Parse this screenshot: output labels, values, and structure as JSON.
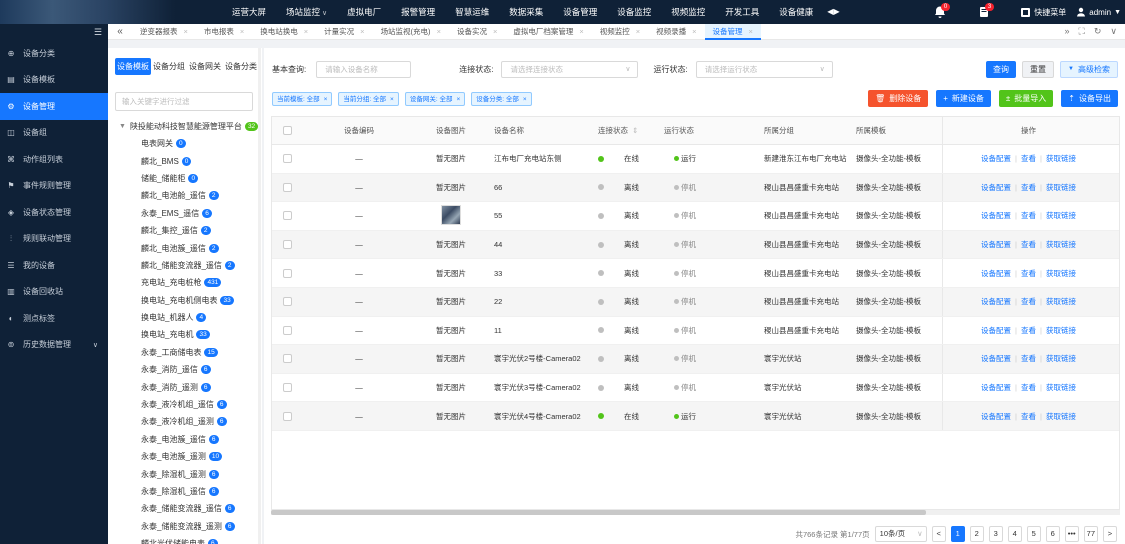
{
  "topnav": {
    "items": [
      "运营大屏",
      "场站监控",
      "虚拟电厂",
      "报警管理",
      "智慧运维",
      "数据采集",
      "设备管理",
      "设备监控",
      "视频监控",
      "开发工具",
      "设备健康"
    ],
    "alarm_badge": "0",
    "message_badge": "3",
    "quick_menu": "快捷菜单",
    "user": "admin"
  },
  "sidebar": {
    "items": [
      {
        "label": "设备分类",
        "icon": "classify-icon"
      },
      {
        "label": "设备模板",
        "icon": "template-icon"
      },
      {
        "label": "设备管理",
        "icon": "device-manage-icon"
      },
      {
        "label": "设备组",
        "icon": "group-icon"
      },
      {
        "label": "动作组列表",
        "icon": "action-icon"
      },
      {
        "label": "事件规则管理",
        "icon": "event-icon"
      },
      {
        "label": "设备状态管理",
        "icon": "status-icon"
      },
      {
        "label": "规则联动管理",
        "icon": "rule-icon"
      },
      {
        "label": "我的设备",
        "icon": "my-device-icon"
      },
      {
        "label": "设备回收站",
        "icon": "recycle-icon"
      },
      {
        "label": "测点标签",
        "icon": "tag-icon"
      },
      {
        "label": "历史数据管理",
        "icon": "history-icon"
      }
    ],
    "active_index": 2
  },
  "tabs": [
    "逆变器报表",
    "市电报表",
    "换电站换电",
    "计量实况",
    "场站监视(充电)",
    "设备实况",
    "虚拟电厂档案管理",
    "视频监控",
    "视频录播",
    "设备管理"
  ],
  "active_tab_index": 9,
  "left_panel": {
    "tabs": [
      "设备模板",
      "设备分组",
      "设备网关",
      "设备分类"
    ],
    "filter_placeholder": "输入关键字进行过滤",
    "root": {
      "label": "陕投能动科技智慧能源管理平台",
      "count": "32"
    },
    "nodes": [
      {
        "label": "电表网关",
        "count": "0"
      },
      {
        "label": "麟北_BMS",
        "count": "0"
      },
      {
        "label": "储能_储能柜",
        "count": "0"
      },
      {
        "label": "麟北_电池舱_遥信",
        "count": "2"
      },
      {
        "label": "永泰_EMS_遥信",
        "count": "6"
      },
      {
        "label": "麟北_集控_遥信",
        "count": "2"
      },
      {
        "label": "麟北_电池簇_遥信",
        "count": "2"
      },
      {
        "label": "麟北_储能变流器_遥信",
        "count": "2"
      },
      {
        "label": "充电站_充电桩枪",
        "count": "431"
      },
      {
        "label": "换电站_充电机侧电表",
        "count": "33"
      },
      {
        "label": "换电站_机器人",
        "count": "4"
      },
      {
        "label": "换电站_充电机",
        "count": "33"
      },
      {
        "label": "永泰_工商储电表",
        "count": "15"
      },
      {
        "label": "永泰_消防_遥信",
        "count": "6"
      },
      {
        "label": "永泰_消防_遥测",
        "count": "6"
      },
      {
        "label": "永泰_液冷机组_遥信",
        "count": "6"
      },
      {
        "label": "永泰_液冷机组_遥测",
        "count": "6"
      },
      {
        "label": "永泰_电池簇_遥信",
        "count": "6"
      },
      {
        "label": "永泰_电池簇_遥测",
        "count": "10"
      },
      {
        "label": "永泰_除湿机_遥测",
        "count": "6"
      },
      {
        "label": "永泰_除湿机_遥信",
        "count": "6"
      },
      {
        "label": "永泰_储能变流器_遥信",
        "count": "6"
      },
      {
        "label": "永泰_储能变流器_遥测",
        "count": "6"
      },
      {
        "label": "麟北光伏储能电表",
        "count": "6"
      }
    ]
  },
  "search": {
    "basic_label": "基本查询:",
    "basic_placeholder": "请输入设备名称",
    "conn_label": "连接状态:",
    "conn_placeholder": "请选择连接状态",
    "run_label": "运行状态:",
    "run_placeholder": "请选择运行状态",
    "query": "查询",
    "reset": "重置",
    "advanced": "高级检索"
  },
  "filter_tags": [
    "当前模板: 全部",
    "当前分组: 全部",
    "设备网关: 全部",
    "设备分类: 全部"
  ],
  "actions": {
    "delete": "删除设备",
    "create": "新建设备",
    "import": "批量导入",
    "export": "设备导出"
  },
  "table": {
    "headers": [
      "设备编码",
      "设备图片",
      "设备名称",
      "连接状态",
      "运行状态",
      "所属分组",
      "所属模板",
      "操作"
    ],
    "rows": [
      {
        "code": "—",
        "image": "暂无图片",
        "name": "江布电厂充电站东侧",
        "conn": "在线",
        "run": "运行",
        "group": "新建淮东江布电厂充电站",
        "template": "摄像头-全功能-模板"
      },
      {
        "code": "—",
        "image": "暂无图片",
        "name": "66",
        "conn": "离线",
        "run": "停机",
        "group": "稷山县昌盛重卡充电站",
        "template": "摄像头-全功能-模板"
      },
      {
        "code": "—",
        "image": "",
        "name": "55",
        "conn": "离线",
        "run": "停机",
        "group": "稷山县昌盛重卡充电站",
        "template": "摄像头-全功能-模板"
      },
      {
        "code": "—",
        "image": "暂无图片",
        "name": "44",
        "conn": "离线",
        "run": "停机",
        "group": "稷山县昌盛重卡充电站",
        "template": "摄像头-全功能-模板"
      },
      {
        "code": "—",
        "image": "暂无图片",
        "name": "33",
        "conn": "离线",
        "run": "停机",
        "group": "稷山县昌盛重卡充电站",
        "template": "摄像头-全功能-模板"
      },
      {
        "code": "—",
        "image": "暂无图片",
        "name": "22",
        "conn": "离线",
        "run": "停机",
        "group": "稷山县昌盛重卡充电站",
        "template": "摄像头-全功能-模板"
      },
      {
        "code": "—",
        "image": "暂无图片",
        "name": "11",
        "conn": "离线",
        "run": "停机",
        "group": "稷山县昌盛重卡充电站",
        "template": "摄像头-全功能-模板"
      },
      {
        "code": "—",
        "image": "暂无图片",
        "name": "寰宇光伏2号楼-Camera02",
        "conn": "离线",
        "run": "停机",
        "group": "寰宇光伏站",
        "template": "摄像头-全功能-模板"
      },
      {
        "code": "—",
        "image": "暂无图片",
        "name": "寰宇光伏3号楼-Camera02",
        "conn": "离线",
        "run": "停机",
        "group": "寰宇光伏站",
        "template": "摄像头-全功能-模板"
      },
      {
        "code": "—",
        "image": "暂无图片",
        "name": "寰宇光伏4号楼-Camera02",
        "conn": "在线",
        "run": "运行",
        "group": "寰宇光伏站",
        "template": "摄像头-全功能-模板"
      }
    ],
    "op_config": "设备配置",
    "op_view": "查看",
    "op_link": "获取链接"
  },
  "pagination": {
    "total": "共766条记录 第1/77页",
    "page_size": "10条/页",
    "pages": [
      "1",
      "2",
      "3",
      "4",
      "5",
      "6",
      "•••",
      "77"
    ],
    "current": "1"
  },
  "colors": {
    "online": "#52c41a",
    "offline": "#bfbfbf",
    "primary": "#1677ff",
    "sidebar_bg": "#0f2137",
    "danger": "#f5532d"
  }
}
